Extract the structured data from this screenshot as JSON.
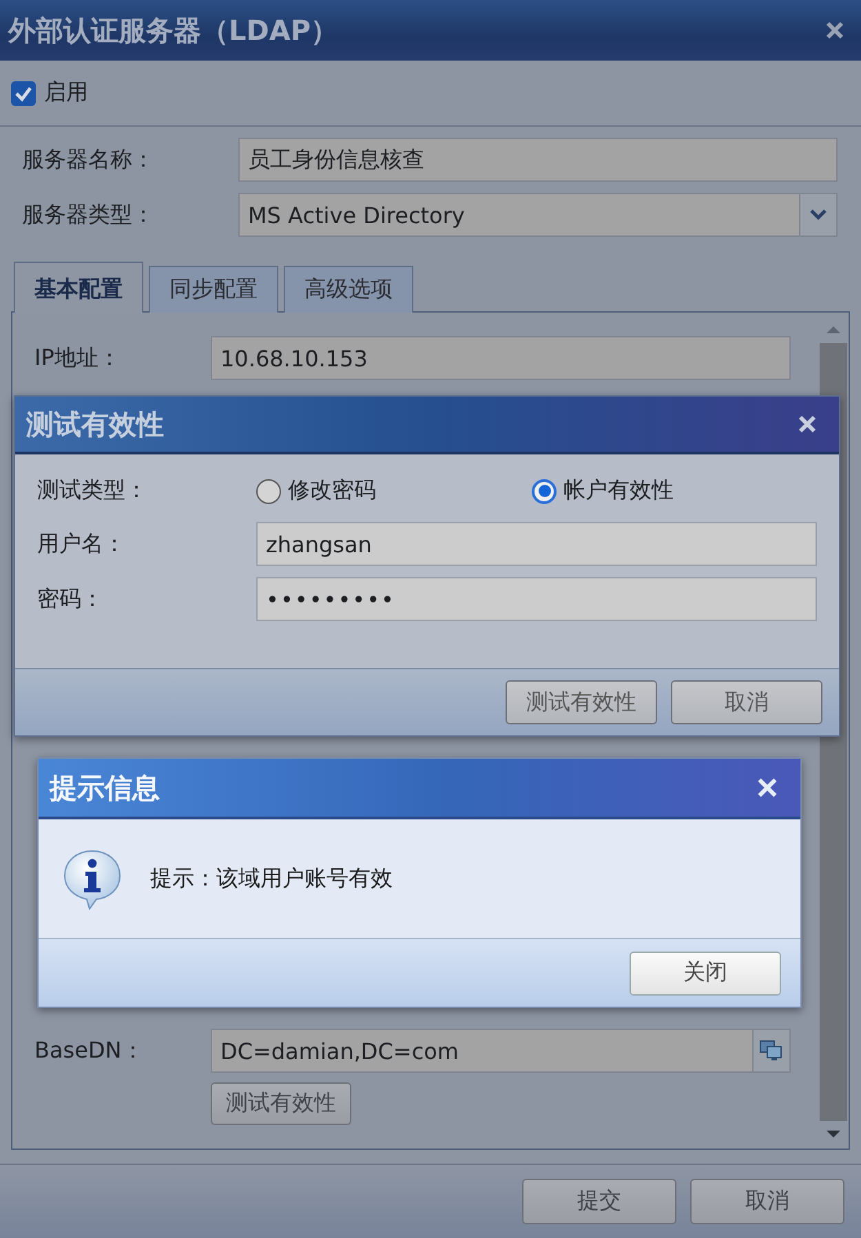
{
  "window": {
    "title": "外部认证服务器（LDAP）"
  },
  "enable": {
    "label": "启用",
    "checked": true
  },
  "fields": [
    {
      "label": "服务器名称：",
      "value": "员工身份信息核查",
      "kind": "text"
    },
    {
      "label": "服务器类型：",
      "value": "MS Active Directory",
      "kind": "select"
    }
  ],
  "tabs": [
    {
      "label": "基本配置",
      "selected": true
    },
    {
      "label": "同步配置",
      "selected": false
    },
    {
      "label": "高级选项",
      "selected": false
    }
  ],
  "basic": {
    "ip": {
      "label": "IP地址：",
      "value": "10.68.10.153"
    },
    "basedn": {
      "label": "BaseDN：",
      "value": "DC=damian,DC=com"
    },
    "test_button": "测试有效性"
  },
  "footer_buttons": [
    "提交",
    "取消"
  ],
  "test_dialog": {
    "title": "测试有效性",
    "type_label": "测试类型：",
    "options": [
      {
        "label": "修改密码",
        "selected": false
      },
      {
        "label": "帐户有效性",
        "selected": true
      }
    ],
    "username": {
      "label": "用户名：",
      "value": "zhangsan"
    },
    "password": {
      "label": "密码：",
      "value": "•••••••••"
    },
    "buttons": [
      "测试有效性",
      "取消"
    ]
  },
  "message_dialog": {
    "title": "提示信息",
    "message": "提示：该域用户账号有效",
    "buttons": [
      "关闭"
    ]
  }
}
